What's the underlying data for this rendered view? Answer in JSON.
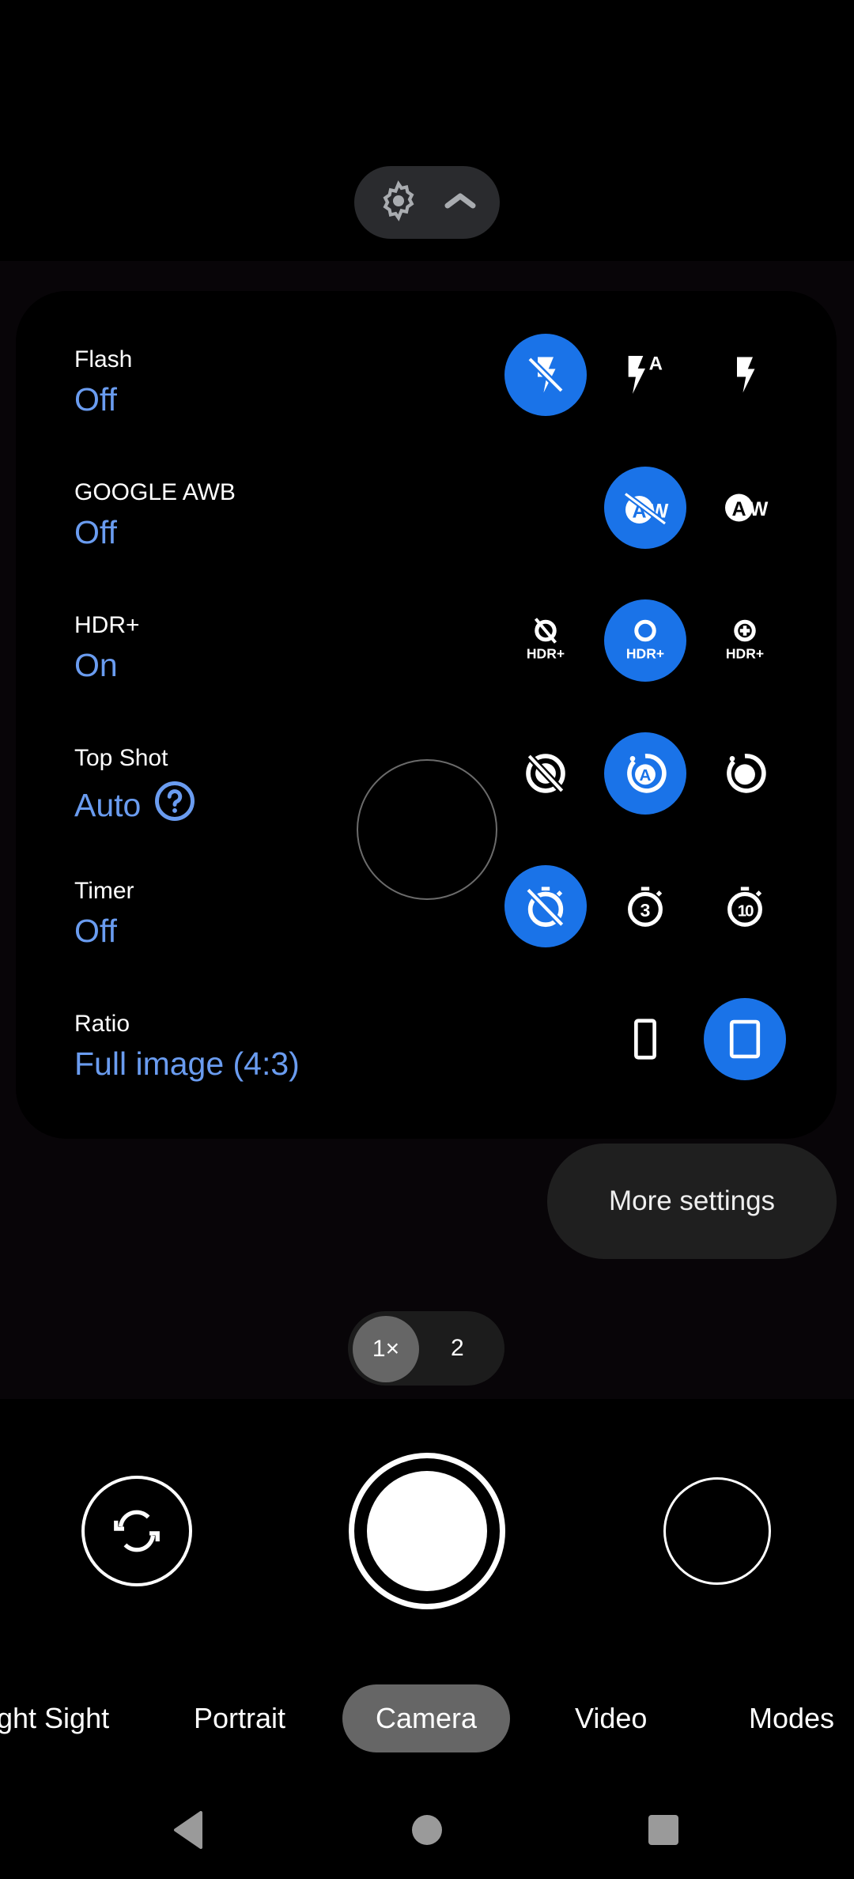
{
  "top_toggle": {
    "settings_icon": "gear-icon",
    "collapse_icon": "chevron-up-icon"
  },
  "settings": {
    "flash": {
      "label": "Flash",
      "value": "Off",
      "options": [
        "flash-off",
        "flash-auto",
        "flash-on"
      ],
      "selected": 0
    },
    "awb": {
      "label": "GOOGLE AWB",
      "value": "Off",
      "options": [
        "awb-off",
        "awb-on"
      ],
      "selected": 0
    },
    "hdr": {
      "label": "HDR+",
      "value": "On",
      "options": [
        "hdr-off",
        "hdr-on",
        "hdr-enhanced"
      ],
      "selected": 1,
      "icon_text": "HDR+"
    },
    "topshot": {
      "label": "Top Shot",
      "value": "Auto",
      "help_icon": "help-circle-icon",
      "options": [
        "topshot-off",
        "topshot-auto",
        "topshot-on"
      ],
      "selected": 1
    },
    "timer": {
      "label": "Timer",
      "value": "Off",
      "options": [
        "timer-off",
        "timer-3s",
        "timer-10s"
      ],
      "selected": 0,
      "timer3": "3",
      "timer10": "10"
    },
    "ratio": {
      "label": "Ratio",
      "value": "Full image (4:3)",
      "options": [
        "ratio-16-9",
        "ratio-4-3"
      ],
      "selected": 1
    }
  },
  "more_settings_label": "More settings",
  "zoom": {
    "options": [
      "1×",
      "2"
    ],
    "selected": "1×"
  },
  "modes": {
    "items": [
      "ght Sight",
      "Portrait",
      "Camera",
      "Video",
      "Modes"
    ],
    "active": "Camera"
  },
  "colors": {
    "accent": "#1a73e8",
    "value_text": "#6a9cf0"
  }
}
